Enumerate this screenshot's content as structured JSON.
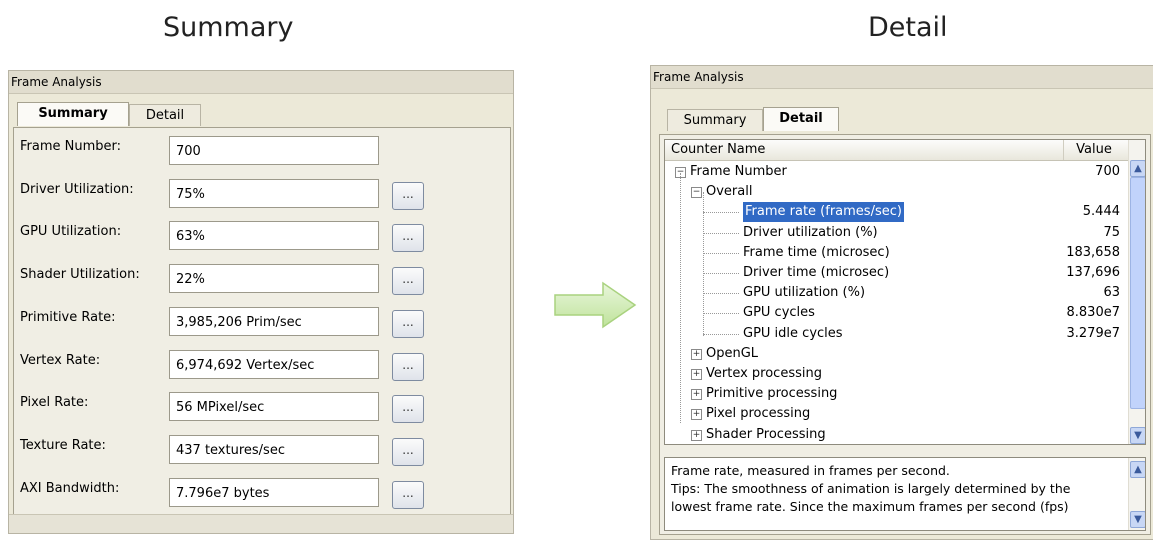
{
  "captions": {
    "summary": "Summary",
    "detail": "Detail"
  },
  "left_panel": {
    "title": "Frame Analysis",
    "tabs": [
      "Summary",
      "Detail"
    ],
    "active_tab": "Summary",
    "rows": [
      {
        "label": "Frame Number:",
        "value": "700",
        "has_button": false
      },
      {
        "label": "Driver Utilization:",
        "value": "75%",
        "has_button": true
      },
      {
        "label": "GPU Utilization:",
        "value": "63%",
        "has_button": true
      },
      {
        "label": "Shader Utilization:",
        "value": "22%",
        "has_button": true
      },
      {
        "label": "Primitive Rate:",
        "value": "3,985,206 Prim/sec",
        "has_button": true
      },
      {
        "label": "Vertex Rate:",
        "value": "6,974,692 Vertex/sec",
        "has_button": true
      },
      {
        "label": "Pixel Rate:",
        "value": "56 MPixel/sec",
        "has_button": true
      },
      {
        "label": "Texture Rate:",
        "value": "437 textures/sec",
        "has_button": true
      },
      {
        "label": "AXI Bandwidth:",
        "value": "7.796e7 bytes",
        "has_button": true
      }
    ],
    "button_label": "..."
  },
  "arrow": {
    "color": "#c9e8a8",
    "icon": "right-arrow-icon"
  },
  "right_panel": {
    "title": "Frame Analysis",
    "tabs": [
      "Summary",
      "Detail"
    ],
    "active_tab": "Detail",
    "columns": {
      "name": "Counter Name",
      "value": "Value"
    },
    "tree": [
      {
        "label": "Frame Number",
        "value": "700",
        "level": 0,
        "expander": "minus"
      },
      {
        "label": "Overall",
        "value": "",
        "level": 1,
        "expander": "minus"
      },
      {
        "label": "Frame rate (frames/sec)",
        "value": "5.444",
        "level": 2,
        "selected": true
      },
      {
        "label": "Driver utilization (%)",
        "value": "75",
        "level": 2
      },
      {
        "label": "Frame time (microsec)",
        "value": "183,658",
        "level": 2
      },
      {
        "label": "Driver time (microsec)",
        "value": "137,696",
        "level": 2
      },
      {
        "label": "GPU utilization (%)",
        "value": "63",
        "level": 2
      },
      {
        "label": "GPU cycles",
        "value": "8.830e7",
        "level": 2
      },
      {
        "label": "GPU idle cycles",
        "value": "3.279e7",
        "level": 2
      },
      {
        "label": "OpenGL",
        "value": "",
        "level": 1,
        "expander": "plus"
      },
      {
        "label": "Vertex processing",
        "value": "",
        "level": 1,
        "expander": "plus"
      },
      {
        "label": "Primitive processing",
        "value": "",
        "level": 1,
        "expander": "plus"
      },
      {
        "label": "Pixel processing",
        "value": "",
        "level": 1,
        "expander": "plus"
      },
      {
        "label": "Shader Processing",
        "value": "",
        "level": 1,
        "expander": "plus"
      }
    ],
    "description": [
      "Frame rate, measured in frames per second.",
      "Tips: The smoothness of animation is largely determined by the",
      "lowest frame rate. Since the maximum frames per second (fps)"
    ],
    "scroll_up": "▲",
    "scroll_down": "▼"
  }
}
